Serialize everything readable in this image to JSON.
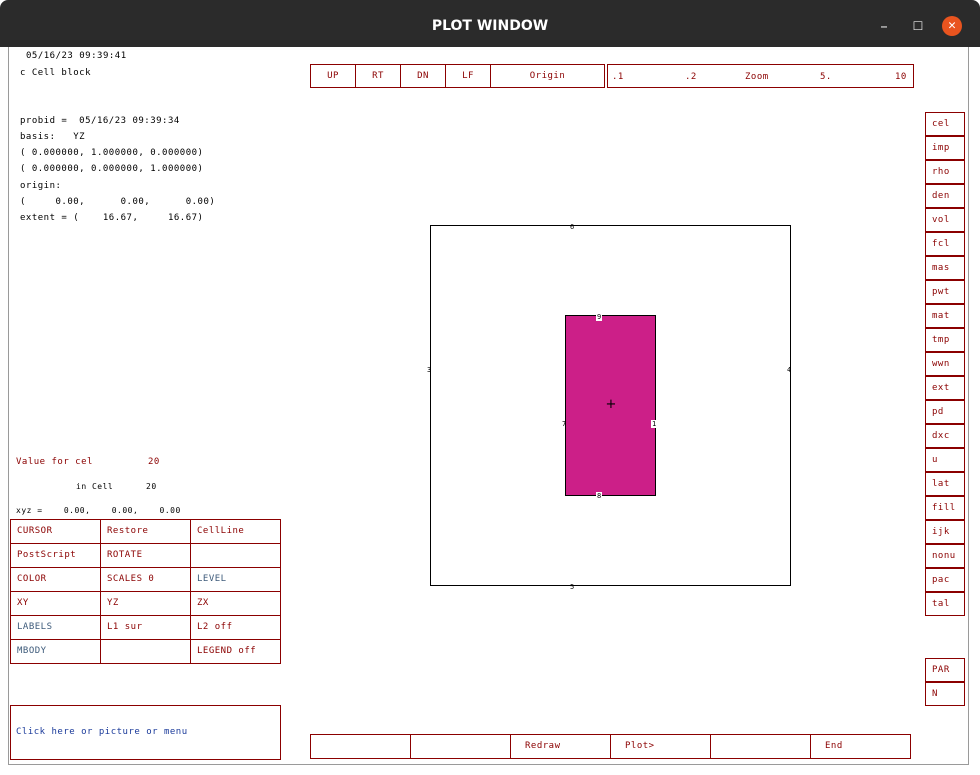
{
  "window": {
    "title": "PLOT WINDOW",
    "minimize": "–",
    "maximize": "☐",
    "close": "✕"
  },
  "info": {
    "timestamp": "05/16/23 09:39:41",
    "comment": "c Cell block",
    "probid": "probid =  05/16/23 09:39:34",
    "basis": "basis:   YZ",
    "basis_row1": "( 0.000000, 1.000000, 0.000000)",
    "basis_row2": "( 0.000000, 0.000000, 1.000000)",
    "origin_label": "origin:",
    "origin_value": "(     0.00,      0.00,      0.00)",
    "extent": "extent = (    16.67,     16.67)"
  },
  "top_nav": {
    "up": "UP",
    "rt": "RT",
    "dn": "DN",
    "lf": "LF",
    "origin": "Origin"
  },
  "zoom_bar": {
    "z1": ".1",
    "z2": ".2",
    "zoom": "Zoom",
    "z5": "5.",
    "z10": "10"
  },
  "value_panel": {
    "value_label": "Value for cel",
    "value": "20",
    "in_cell_label": "in Cell",
    "in_cell": "20",
    "xyz": "xyz =    0.00,    0.00,    0.00"
  },
  "menu": {
    "rows": [
      [
        "CURSOR",
        "Restore",
        "CellLine"
      ],
      [
        "PostScript",
        "ROTATE",
        ""
      ],
      [
        "COLOR",
        "SCALES 0",
        "LEVEL"
      ],
      [
        "XY",
        "YZ",
        "ZX"
      ],
      [
        "LABELS",
        "L1 sur",
        "L2 off"
      ],
      [
        "MBODY",
        "",
        "LEGEND off"
      ]
    ]
  },
  "side_menu": [
    "cel",
    "imp",
    "rho",
    "den",
    "vol",
    "fcl",
    "mas",
    "pwt",
    "mat",
    "tmp",
    "wwn",
    "ext",
    "pd",
    "dxc",
    "u",
    "lat",
    "fill",
    "ijk",
    "nonu",
    "pac",
    "tal"
  ],
  "side_extra": [
    "PAR",
    "N"
  ],
  "bottom_bar": {
    "b1": "",
    "b2": "",
    "redraw": "Redraw",
    "plot": "Plot>",
    "b5": "",
    "end": "End"
  },
  "status": {
    "prompt": "Click here or picture or menu"
  },
  "plot": {
    "surf_top": "6",
    "surf_bottom": "5",
    "surf_left": "3",
    "surf_right": "4",
    "cell_top": "9",
    "cell_bottom": "8",
    "cell_left": "7",
    "cell_right": "1",
    "origin_marker": "+",
    "cell_color": "#cc1f88"
  }
}
